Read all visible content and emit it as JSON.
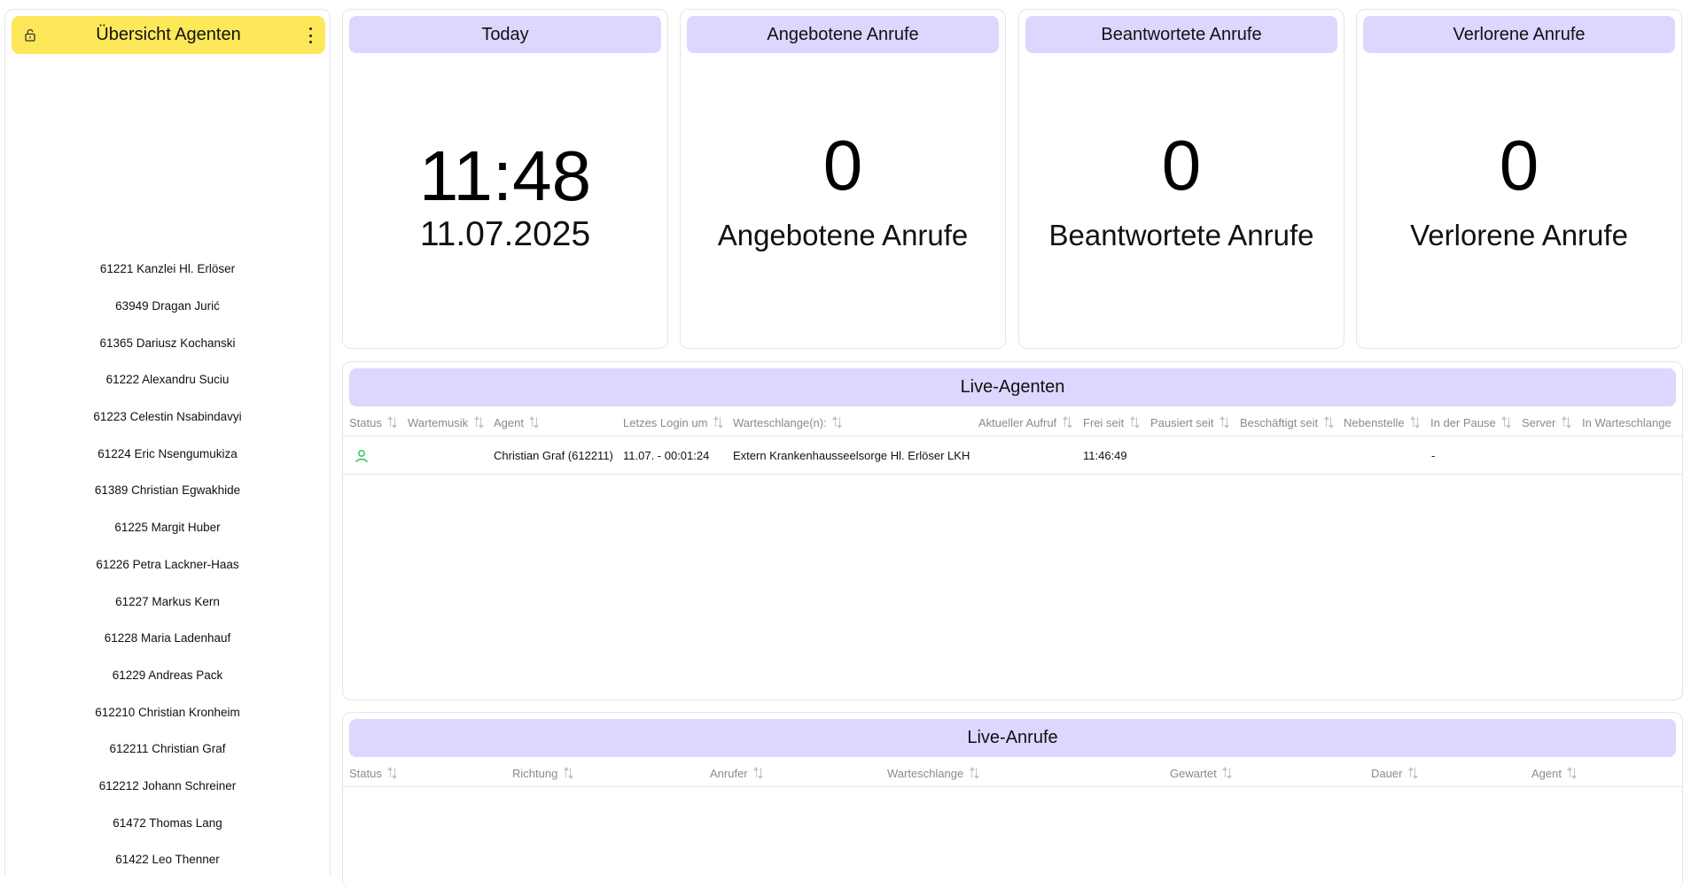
{
  "sidebar": {
    "title": "Übersicht Agenten",
    "agents": [
      "61221 Kanzlei Hl. Erlöser",
      "63949 Dragan Jurić",
      "61365 Dariusz Kochanski",
      "61222 Alexandru Suciu",
      "61223 Celestin Nsabindavyi",
      "61224 Eric Nsengumukiza",
      "61389 Christian Egwakhide",
      "61225 Margit Huber",
      "61226 Petra Lackner-Haas",
      "61227 Markus Kern",
      "61228 Maria Ladenhauf",
      "61229 Andreas Pack",
      "612210 Christian Kronheim",
      "612211 Christian Graf",
      "612212 Johann Schreiner",
      "61472 Thomas Lang",
      "61422 Leo Thenner"
    ]
  },
  "cards": {
    "today": {
      "title": "Today",
      "time": "11:48",
      "date": "11.07.2025"
    },
    "offered": {
      "title": "Angebotene Anrufe",
      "value": "0",
      "label": "Angebotene Anrufe"
    },
    "answered": {
      "title": "Beantwortete Anrufe",
      "value": "0",
      "label": "Beantwortete Anrufe"
    },
    "lost": {
      "title": "Verlorene Anrufe",
      "value": "0",
      "label": "Verlorene Anrufe"
    }
  },
  "live_agents": {
    "title": "Live-Agenten",
    "columns": [
      "Status",
      "Wartemusik",
      "Agent",
      "Letzes Login um",
      "Warteschlange(n):",
      "Aktueller Aufruf",
      "Frei seit",
      "Pausiert seit",
      "Beschäftigt seit",
      "Nebenstelle",
      "In der Pause",
      "Server",
      "In Warteschlange"
    ],
    "rows": [
      {
        "status": "user-icon",
        "music": "",
        "agent": "Christian Graf (612211)",
        "last_login": "11.07. - 00:01:24",
        "queues": "Extern Krankenhausseelsorge Hl. Erlöser LKH",
        "current_call": "",
        "free_since": "11:46:49",
        "paused_since": "",
        "busy_since": "",
        "extension": "",
        "in_pause": "-",
        "server": "",
        "in_queue": ""
      }
    ]
  },
  "live_calls": {
    "title": "Live-Anrufe",
    "columns": [
      "Status",
      "Richtung",
      "Anrufer",
      "Warteschlange",
      "Gewartet",
      "Dauer",
      "Agent"
    ]
  },
  "colors": {
    "sidebar_header": "#fde85a",
    "card_header": "#ddd6fe",
    "status_available": "#22c55e"
  },
  "icons": {
    "lock": "lock-icon",
    "menu": "more-vertical-icon",
    "sort": "sort-icon",
    "status": "user-icon"
  }
}
